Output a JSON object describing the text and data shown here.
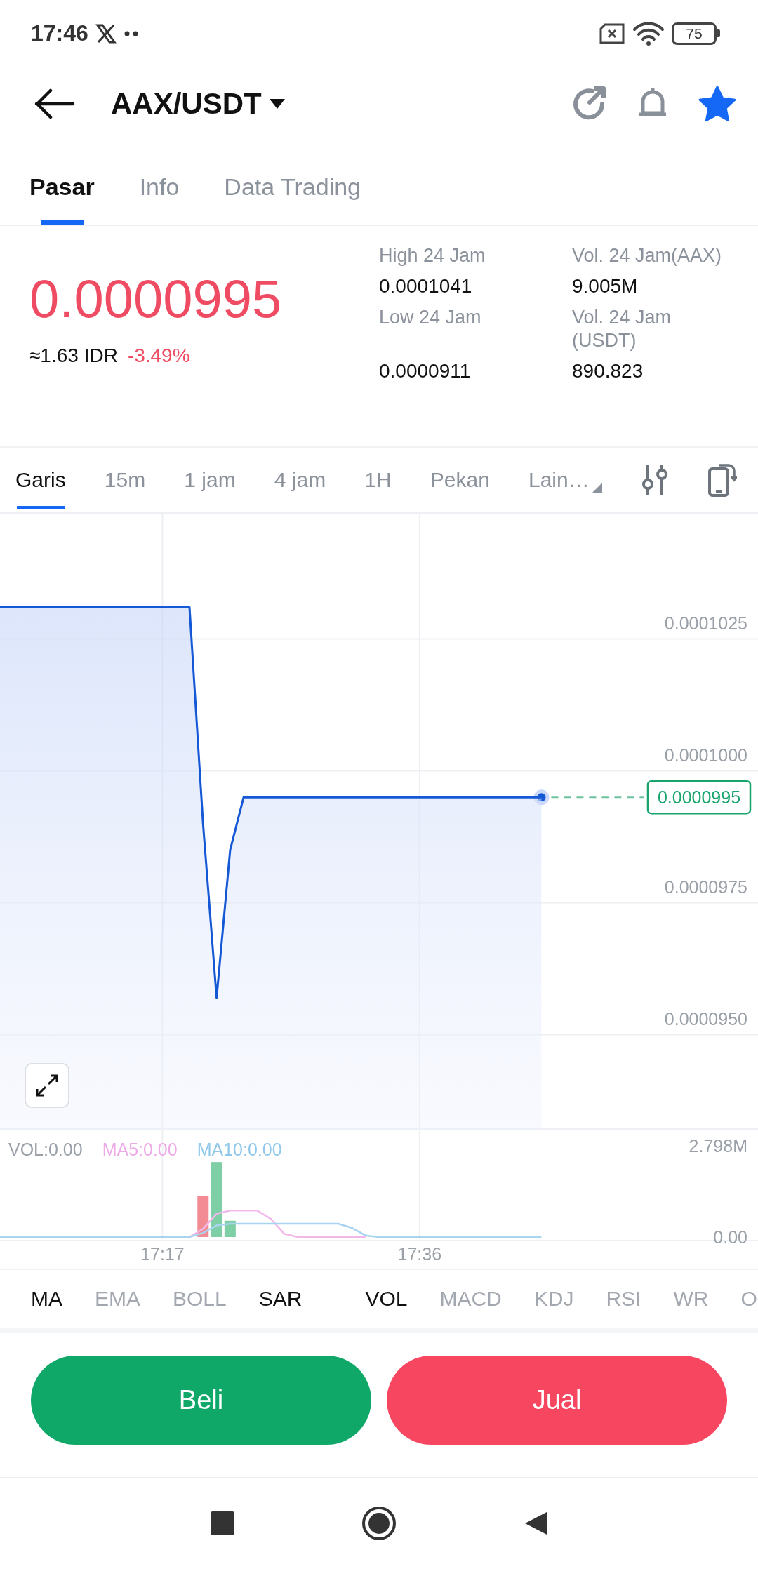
{
  "status_bar": {
    "time": "17:46",
    "battery": "75"
  },
  "header": {
    "title": "AAX/USDT",
    "favorite": true
  },
  "tabs": [
    {
      "label": "Pasar",
      "selected": true
    },
    {
      "label": "Info",
      "selected": false
    },
    {
      "label": "Data Trading",
      "selected": false
    }
  ],
  "ticker": {
    "price": "0.0000995",
    "converted": "≈1.63 IDR",
    "change": "-3.49%",
    "stats": [
      {
        "label": "High 24 Jam",
        "value": "0.0001041"
      },
      {
        "label": "Vol. 24 Jam(AAX)",
        "value": "9.005M"
      },
      {
        "label": "Low 24 Jam",
        "value": "0.0000911"
      },
      {
        "label": "Vol. 24 Jam (USDT)",
        "value": "890.823"
      }
    ]
  },
  "intervals": [
    {
      "label": "Garis",
      "selected": true,
      "kind": "plain"
    },
    {
      "label": "15m",
      "selected": false,
      "kind": "plain"
    },
    {
      "label": "1 jam",
      "selected": false,
      "kind": "plain"
    },
    {
      "label": "4 jam",
      "selected": false,
      "kind": "plain"
    },
    {
      "label": "1H",
      "selected": false,
      "kind": "plain"
    },
    {
      "label": "Pekan",
      "selected": false,
      "kind": "plain"
    },
    {
      "label": "Lain…",
      "selected": false,
      "kind": "menu"
    }
  ],
  "price_chart": {
    "current_label": "0.0000995",
    "chart_data": {
      "type": "area",
      "grid": true,
      "series": [
        {
          "color": "#1558d6",
          "values": [
            0.0001031,
            0.0001031,
            0.0001031,
            0.0001031,
            0.0001031,
            0.0001031,
            0.0001031,
            0.0001031,
            0.0001031,
            0.0001031,
            0.0001031,
            0.0001031,
            0.0001031,
            0.0001031,
            0.0001031,
            9.9e-05,
            9.57e-05,
            9.85e-05,
            9.95e-05,
            9.95e-05,
            9.95e-05,
            9.95e-05,
            9.95e-05,
            9.95e-05,
            9.95e-05,
            9.95e-05,
            9.95e-05,
            9.95e-05,
            9.95e-05,
            9.95e-05,
            9.95e-05,
            9.95e-05,
            9.95e-05,
            9.95e-05,
            9.95e-05,
            9.95e-05,
            9.95e-05,
            9.95e-05,
            9.95e-05,
            9.95e-05,
            9.95e-05,
            null,
            null,
            null,
            null,
            null,
            null,
            null,
            null,
            null,
            null,
            null,
            null,
            null,
            null,
            null,
            null
          ]
        }
      ],
      "ylim": [
        9.32e-05,
        0.0001049
      ],
      "yticks": [
        {
          "value": 0.0001025,
          "label": "0.0001025"
        },
        {
          "value": 0.0001,
          "label": "0.0001000"
        },
        {
          "value": 9.75e-05,
          "label": "0.0000975"
        },
        {
          "value": 9.5e-05,
          "label": "0.0000950"
        }
      ]
    }
  },
  "volume_chart": {
    "legend": [
      {
        "text": "VOL:0.00",
        "color": "#9aa0a8"
      },
      {
        "text": "MA5:0.00",
        "color": "#eeaae6"
      },
      {
        "text": "MA10:0.00",
        "color": "#8fc8ea"
      }
    ],
    "chart_data": {
      "type": "bar",
      "categories": [
        null,
        null,
        null,
        null,
        null,
        null,
        null,
        null,
        null,
        null,
        null,
        null,
        "17:17",
        null,
        null,
        null,
        null,
        null,
        null,
        null,
        null,
        null,
        null,
        null,
        null,
        null,
        null,
        null,
        null,
        null,
        null,
        "17:36",
        null,
        null,
        null,
        null,
        null,
        null,
        null,
        null,
        null,
        null,
        null,
        null,
        null,
        null,
        null,
        null,
        null,
        null,
        null,
        null,
        null,
        null,
        null,
        null,
        null
      ],
      "series": [
        {
          "type": "bar",
          "color": "#f28b93",
          "values": [
            null,
            null,
            null,
            null,
            null,
            null,
            null,
            null,
            null,
            null,
            null,
            null,
            null,
            null,
            null,
            1270000,
            null,
            null,
            null,
            null,
            null,
            null,
            null,
            null,
            null,
            null,
            null,
            null,
            null,
            null,
            null,
            null,
            null,
            null,
            null,
            null,
            null,
            null,
            null,
            null,
            null,
            null,
            null,
            null,
            null,
            null,
            null,
            null,
            null,
            null,
            null,
            null,
            null,
            null,
            null,
            null,
            null
          ]
        },
        {
          "type": "bar",
          "color": "#7fcfa6",
          "values": [
            null,
            null,
            null,
            null,
            null,
            null,
            null,
            null,
            null,
            null,
            null,
            null,
            null,
            null,
            null,
            null,
            2300000,
            500000,
            null,
            null,
            null,
            null,
            null,
            null,
            null,
            null,
            null,
            null,
            null,
            null,
            null,
            null,
            null,
            null,
            null,
            null,
            null,
            null,
            null,
            null,
            null,
            null,
            null,
            null,
            null,
            null,
            null,
            null,
            null,
            null,
            null,
            null,
            null,
            null,
            null,
            null,
            null
          ]
        },
        {
          "type": "line",
          "color": "#f2b8ea",
          "values": [
            null,
            null,
            null,
            null,
            null,
            null,
            null,
            null,
            null,
            null,
            null,
            null,
            null,
            null,
            0,
            254000,
            714000,
            814000,
            814000,
            814000,
            560000,
            100000,
            0,
            0,
            0,
            0,
            0,
            0,
            null,
            null,
            null,
            null,
            null,
            null,
            null,
            null,
            null,
            null,
            null,
            null,
            null,
            null,
            null,
            null,
            null,
            null,
            null,
            null,
            null,
            null,
            null,
            null,
            null,
            null,
            null,
            null,
            null
          ]
        },
        {
          "type": "line",
          "color": "#a8d4f0",
          "values": [
            0,
            0,
            0,
            0,
            0,
            0,
            0,
            0,
            0,
            0,
            0,
            0,
            0,
            0,
            0,
            127000,
            357000,
            407000,
            407000,
            407000,
            407000,
            407000,
            407000,
            407000,
            407000,
            407000,
            280000,
            50000,
            0,
            0,
            0,
            0,
            0,
            0,
            0,
            0,
            0,
            0,
            0,
            0,
            0,
            null,
            null,
            null,
            null,
            null,
            null,
            null,
            null,
            null,
            null,
            null,
            null,
            null,
            null,
            null,
            null
          ]
        }
      ],
      "ylim": [
        0,
        2798000
      ],
      "yticks": [
        {
          "value": 0,
          "label": "0.00"
        },
        {
          "value": 2798000,
          "label": "2.798M"
        }
      ]
    }
  },
  "indicators": {
    "main": [
      {
        "label": "MA",
        "selected": true
      },
      {
        "label": "EMA",
        "selected": false
      },
      {
        "label": "BOLL",
        "selected": false
      },
      {
        "label": "SAR",
        "selected": true
      }
    ],
    "sub": [
      {
        "label": "VOL",
        "selected": true
      },
      {
        "label": "MACD",
        "selected": false
      },
      {
        "label": "KDJ",
        "selected": false
      },
      {
        "label": "RSI",
        "selected": false
      },
      {
        "label": "WR",
        "selected": false
      },
      {
        "label": "O",
        "selected": false
      }
    ]
  },
  "actions": [
    {
      "label": "Beli",
      "kind": "buy"
    },
    {
      "label": "Jual",
      "kind": "sell"
    }
  ]
}
